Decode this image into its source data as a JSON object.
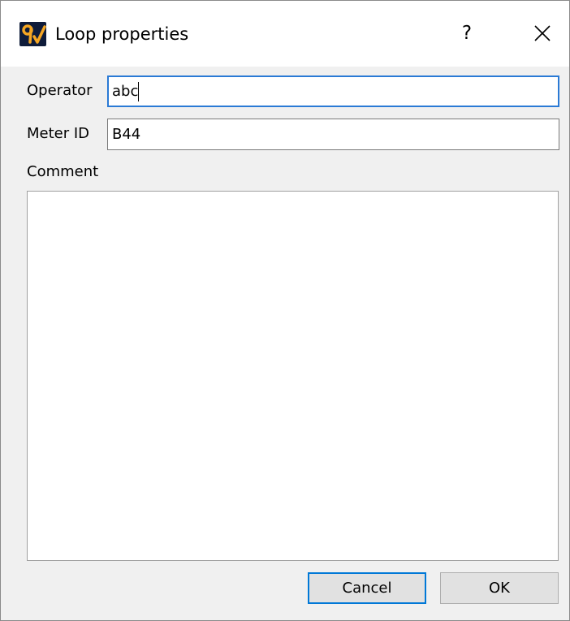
{
  "window": {
    "title": "Loop properties",
    "help_label": "?",
    "app_icon": "app-logo-icon",
    "close_icon": "close-icon"
  },
  "form": {
    "operator": {
      "label": "Operator",
      "value": "abc"
    },
    "meter_id": {
      "label": "Meter ID",
      "value": "B44"
    },
    "comment": {
      "label": "Comment",
      "value": ""
    }
  },
  "buttons": {
    "cancel": "Cancel",
    "ok": "OK"
  },
  "colors": {
    "focus_border": "#2a7ad5",
    "default_button_border": "#0078d7",
    "app_icon_bg": "#0f1c3a",
    "app_icon_glyph": "#f5a623"
  }
}
